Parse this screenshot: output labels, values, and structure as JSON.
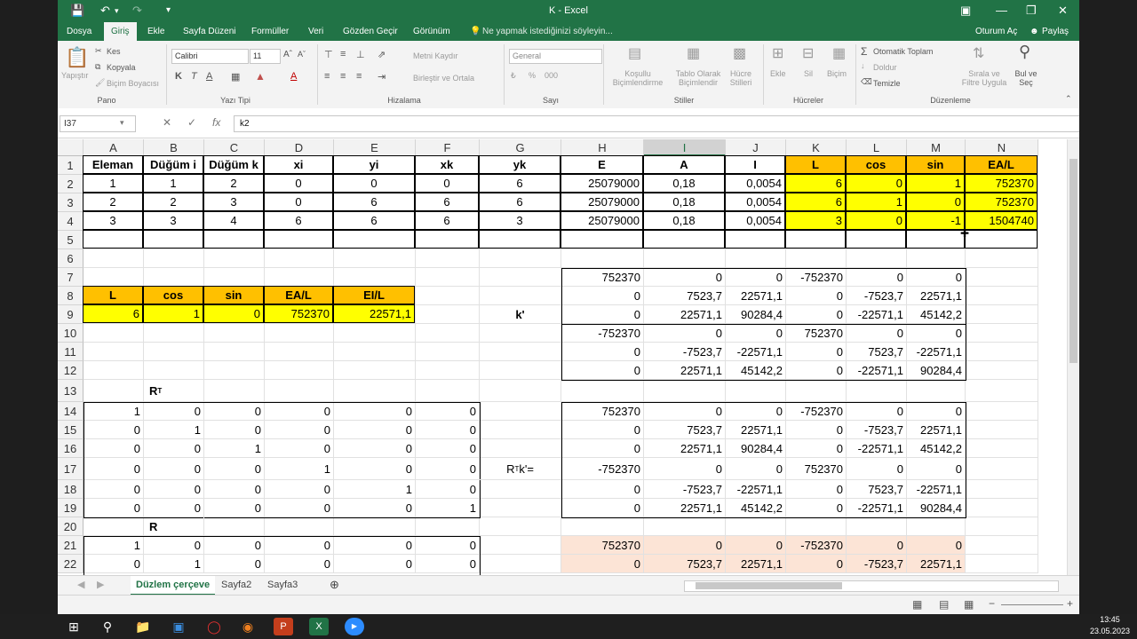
{
  "window": {
    "title": "K - Excel"
  },
  "menu": {
    "items": [
      "Dosya",
      "Giriş",
      "Ekle",
      "Sayfa Düzeni",
      "Formüller",
      "Veri",
      "Gözden Geçir",
      "Görünüm"
    ],
    "active": "Giriş",
    "tell_me": "Ne yapmak istediğinizi söyleyin...",
    "sign_in": "Oturum Aç",
    "share": "Paylaş"
  },
  "ribbon": {
    "paste": "Yapıştır",
    "cut": "Kes",
    "copy": "Kopyala",
    "format_painter": "Biçim Boyacısı",
    "font_name": "Calibri",
    "font_size": "11",
    "wrap_text": "Metni Kaydır",
    "merge_center": "Birleştir ve Ortala",
    "number_format": "General",
    "conditional": "Koşullu Biçimlendirme",
    "table": "Tablo Olarak Biçimlendir",
    "cell_styles": "Hücre Stilleri",
    "insert": "Ekle",
    "delete": "Sil",
    "format": "Biçim",
    "autosum": "Otomatik Toplam",
    "fill": "Doldur",
    "clear": "Temizle",
    "sort_filter": "Sırala ve Filtre Uygula",
    "find_select": "Bul ve Seç",
    "groups": {
      "clipboard": "Pano",
      "font": "Yazı Tipi",
      "alignment": "Hizalama",
      "number": "Sayı",
      "styles": "Stiller",
      "cells": "Hücreler",
      "editing": "Düzenleme"
    }
  },
  "formula_bar": {
    "name_box": "I37",
    "formula": "k2"
  },
  "columns": [
    "A",
    "B",
    "C",
    "D",
    "E",
    "F",
    "G",
    "H",
    "I",
    "J",
    "K",
    "L",
    "M",
    "N"
  ],
  "rows": [
    "1",
    "2",
    "3",
    "4",
    "5",
    "6",
    "7",
    "8",
    "9",
    "10",
    "11",
    "12",
    "13",
    "14",
    "15",
    "16",
    "17",
    "18",
    "19",
    "20",
    "21",
    "22"
  ],
  "table1": {
    "header": [
      "Eleman",
      "Düğüm i",
      "Düğüm k",
      "xi",
      "yi",
      "xk",
      "yk",
      "E",
      "A",
      "I",
      "L",
      "cos",
      "sin",
      "EA/L"
    ],
    "rows": [
      [
        "1",
        "1",
        "2",
        "0",
        "0",
        "0",
        "6",
        "25079000",
        "0,18",
        "0,0054",
        "6",
        "0",
        "1",
        "752370"
      ],
      [
        "2",
        "2",
        "3",
        "0",
        "6",
        "6",
        "6",
        "25079000",
        "0,18",
        "0,0054",
        "6",
        "1",
        "0",
        "752370"
      ],
      [
        "3",
        "3",
        "4",
        "6",
        "6",
        "6",
        "3",
        "25079000",
        "0,18",
        "0,0054",
        "3",
        "0",
        "-1",
        "1504740"
      ]
    ]
  },
  "table2": {
    "header": [
      "L",
      "cos",
      "sin",
      "EA/L",
      "EI/L"
    ],
    "row": [
      "6",
      "1",
      "0",
      "752370",
      "22571,1"
    ]
  },
  "kprime": {
    "label": "k'",
    "rows": [
      [
        "752370",
        "0",
        "0",
        "-752370",
        "0",
        "0"
      ],
      [
        "0",
        "7523,7",
        "22571,1",
        "0",
        "-7523,7",
        "22571,1"
      ],
      [
        "0",
        "22571,1",
        "90284,4",
        "0",
        "-22571,1",
        "45142,2"
      ],
      [
        "-752370",
        "0",
        "0",
        "752370",
        "0",
        "0"
      ],
      [
        "0",
        "-7523,7",
        "-22571,1",
        "0",
        "7523,7",
        "-22571,1"
      ],
      [
        "0",
        "22571,1",
        "45142,2",
        "0",
        "-22571,1",
        "90284,4"
      ]
    ]
  },
  "RT": {
    "label": "R",
    "sup": "T",
    "rows": [
      [
        "1",
        "0",
        "0",
        "0",
        "0",
        "0"
      ],
      [
        "0",
        "1",
        "0",
        "0",
        "0",
        "0"
      ],
      [
        "0",
        "0",
        "1",
        "0",
        "0",
        "0"
      ],
      [
        "0",
        "0",
        "0",
        "1",
        "0",
        "0"
      ],
      [
        "0",
        "0",
        "0",
        "0",
        "1",
        "0"
      ],
      [
        "0",
        "0",
        "0",
        "0",
        "0",
        "1"
      ]
    ]
  },
  "RTk": {
    "label_a": "R",
    "sup": "T",
    "label_b": "k'=",
    "rows": [
      [
        "752370",
        "0",
        "0",
        "-752370",
        "0",
        "0"
      ],
      [
        "0",
        "7523,7",
        "22571,1",
        "0",
        "-7523,7",
        "22571,1"
      ],
      [
        "0",
        "22571,1",
        "90284,4",
        "0",
        "-22571,1",
        "45142,2"
      ],
      [
        "-752370",
        "0",
        "0",
        "752370",
        "0",
        "0"
      ],
      [
        "0",
        "-7523,7",
        "-22571,1",
        "0",
        "7523,7",
        "-22571,1"
      ],
      [
        "0",
        "22571,1",
        "45142,2",
        "0",
        "-22571,1",
        "90284,4"
      ]
    ]
  },
  "R": {
    "label": "R",
    "rows": [
      [
        "1",
        "0",
        "0",
        "0",
        "0",
        "0"
      ],
      [
        "0",
        "1",
        "0",
        "0",
        "0",
        "0"
      ]
    ]
  },
  "bottom_right": {
    "rows": [
      [
        "752370",
        "0",
        "0",
        "-752370",
        "0",
        "0"
      ],
      [
        "0",
        "7523,7",
        "22571,1",
        "0",
        "-7523,7",
        "22571,1"
      ]
    ]
  },
  "sheets": [
    "Düzlem çerçeve",
    "Sayfa2",
    "Sayfa3"
  ],
  "active_sheet": "Düzlem çerçeve",
  "taskbar": {
    "time": "13:45",
    "date": "23.05.2023"
  },
  "colors": {
    "excel_green": "#217346",
    "yellow": "#ffff00",
    "orange": "#ffc000",
    "peach": "#fce4d6"
  }
}
